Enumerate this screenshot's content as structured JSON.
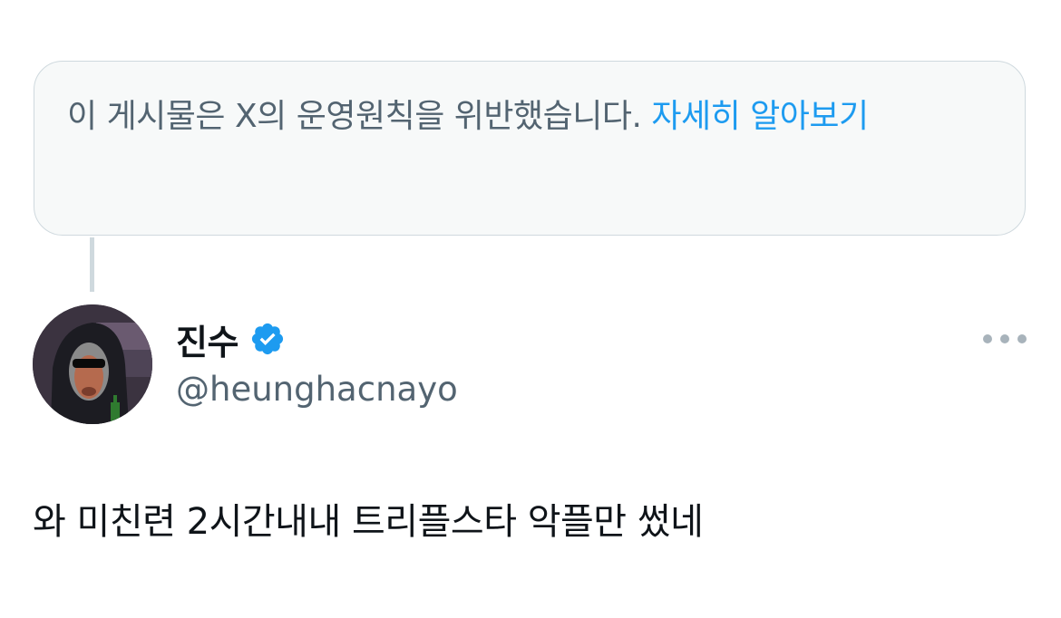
{
  "notice": {
    "text": "이 게시물은 X의 운영원칙을 위반했습니다. ",
    "link_text": "자세히 알아보기"
  },
  "author": {
    "display_name": "진수",
    "handle": "@heunghacnayo",
    "verified": true
  },
  "post": {
    "text": "와 미친련 2시간내내 트리플스타 악플만 썼네"
  },
  "colors": {
    "accent": "#1d9bf0",
    "secondary_text": "#536471",
    "primary_text": "#0f1419",
    "notice_bg": "#f7f9f9",
    "border": "#cfd9de"
  },
  "icons": {
    "verified": "verified-badge-icon",
    "more": "more-options-icon"
  }
}
